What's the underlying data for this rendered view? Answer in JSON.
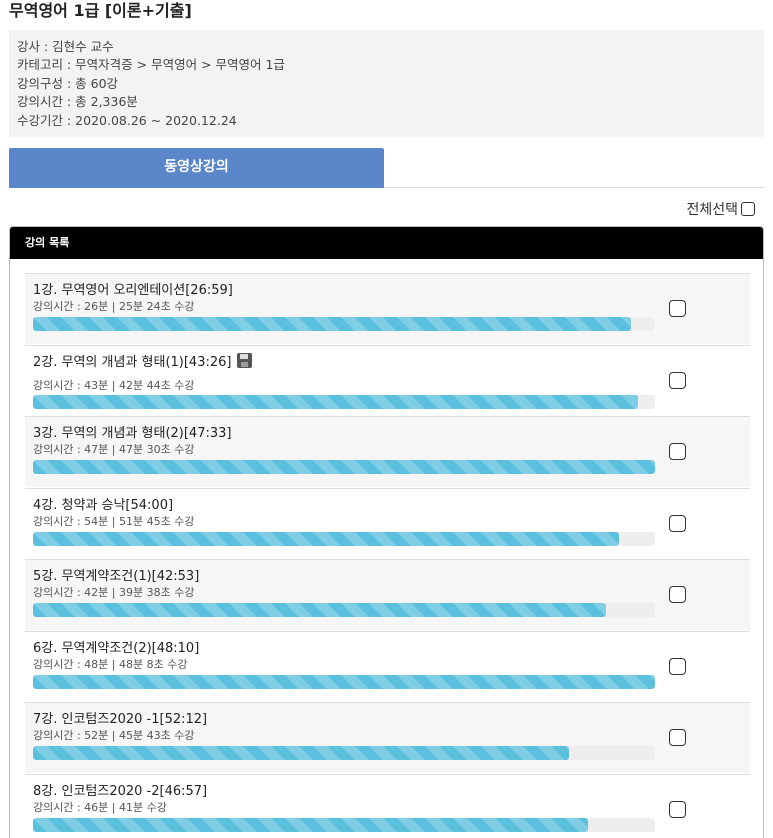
{
  "course": {
    "title": "무역영어 1급 [이론+기출]",
    "info": {
      "instructor": "강사 : 김현수 교수",
      "category": "카테고리 : 무역자격증 > 무역영어 > 무역영어 1급",
      "composition": "강의구성 : 총 60강",
      "total_time": "강의시간 : 총 2,336분",
      "period": "수강기간 : 2020.08.26 ~ 2020.12.24"
    }
  },
  "tabs": [
    {
      "label": "동영상강의",
      "active": true
    }
  ],
  "select_all_label": "전체선택",
  "panel_title": "강의 목록",
  "colors": {
    "tab_active": "#5b86c9",
    "progress": "#5bc0de",
    "header_bg": "#000000"
  },
  "lectures": [
    {
      "title": "1강. 무역영어 오리엔테이션[26:59]",
      "time": "강의시간 : 26분 | 25분 24초 수강",
      "progress": 0.962,
      "has_download": false,
      "checked": false
    },
    {
      "title": "2강. 무역의 개념과 형태(1)[43:26]",
      "time": "강의시간 : 43분 | 42분 44초 수강",
      "progress": 0.972,
      "has_download": true,
      "download_icon": "floppy-disk-icon",
      "checked": false
    },
    {
      "title": "3강. 무역의 개념과 형태(2)[47:33]",
      "time": "강의시간 : 47분 | 47분 30초 수강",
      "progress": 1.0,
      "has_download": false,
      "checked": false
    },
    {
      "title": "4강. 청약과 승낙[54:00]",
      "time": "강의시간 : 54분 | 51분 45초 수강",
      "progress": 0.942,
      "has_download": false,
      "checked": false
    },
    {
      "title": "5강. 무역계약조건(1)[42:53]",
      "time": "강의시간 : 42분 | 39분 38초 수강",
      "progress": 0.922,
      "has_download": false,
      "checked": false
    },
    {
      "title": "6강. 무역계약조건(2)[48:10]",
      "time": "강의시간 : 48분 | 48분 8초 수강",
      "progress": 1.0,
      "has_download": false,
      "checked": false
    },
    {
      "title": "7강. 인코텀즈2020 -1[52:12]",
      "time": "강의시간 : 52분 | 45분 43초 수강",
      "progress": 0.862,
      "has_download": false,
      "checked": false
    },
    {
      "title": "8강. 인코텀즈2020 -2[46:57]",
      "time": "강의시간 : 46분 | 41분 수강",
      "progress": 0.892,
      "has_download": false,
      "checked": false
    }
  ]
}
